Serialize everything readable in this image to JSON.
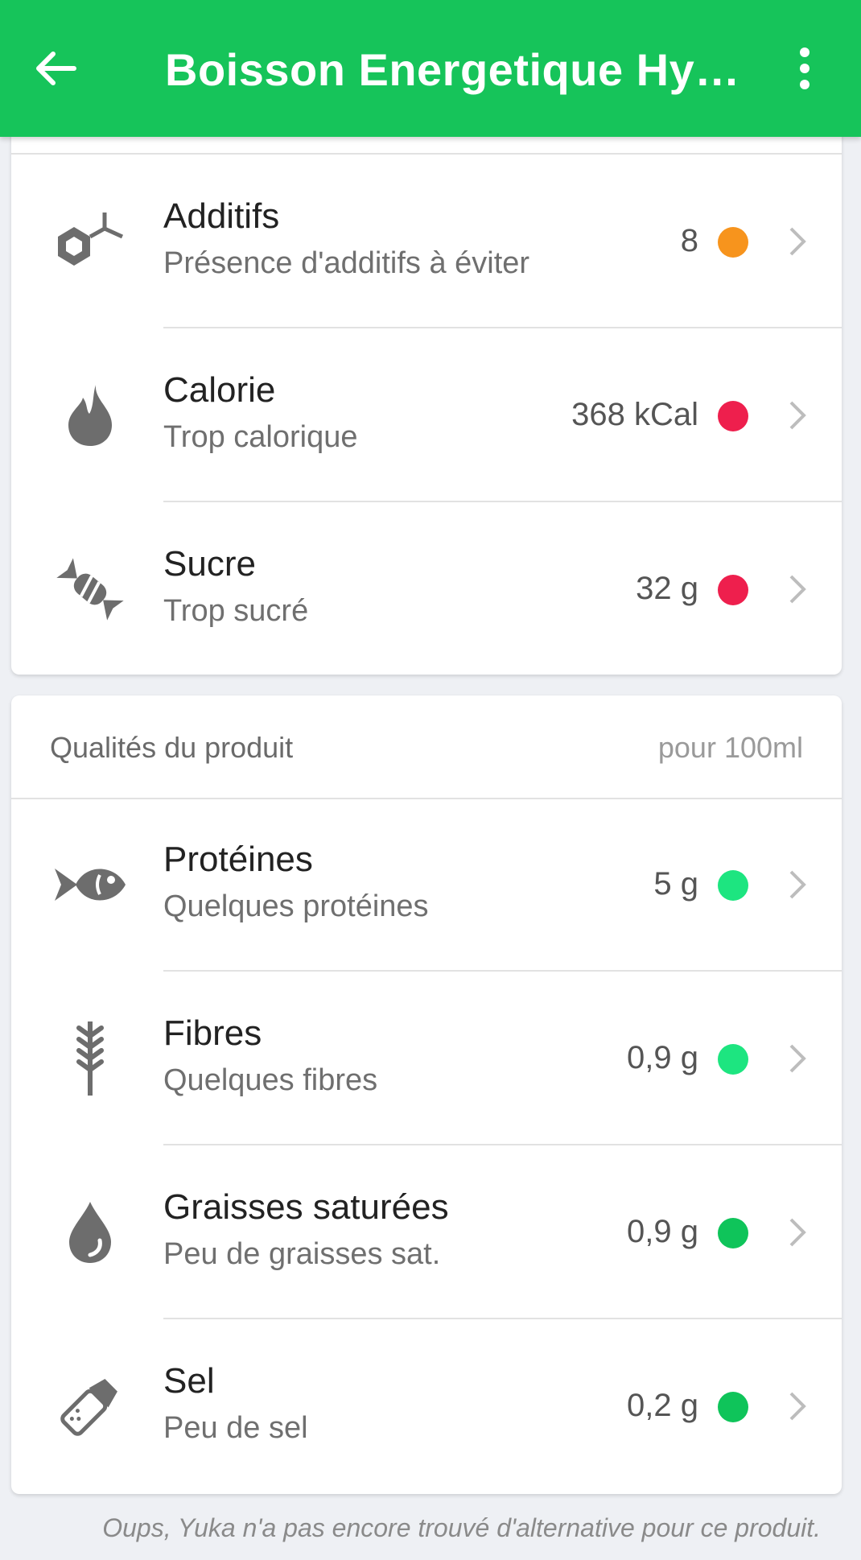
{
  "appbar": {
    "title": "Boisson Energetique Hyd…",
    "back_icon": "arrow-left-icon",
    "menu_icon": "more-vert-icon"
  },
  "defauts": [
    {
      "name": "Additifs",
      "desc": "Présence d'additifs à éviter",
      "value": "8",
      "color": "#f7941d",
      "icon": "molecule-icon"
    },
    {
      "name": "Calorie",
      "desc": "Trop calorique",
      "value": "368 kCal",
      "color": "#ee1f4d",
      "icon": "flame-icon"
    },
    {
      "name": "Sucre",
      "desc": "Trop sucré",
      "value": "32 g",
      "color": "#ee1f4d",
      "icon": "candy-icon"
    }
  ],
  "qualites": {
    "header": "Qualités du produit",
    "unit": "pour 100ml",
    "items": [
      {
        "name": "Protéines",
        "desc": "Quelques protéines",
        "value": "5 g",
        "color": "#1de580",
        "icon": "fish-icon"
      },
      {
        "name": "Fibres",
        "desc": "Quelques fibres",
        "value": "0,9 g",
        "color": "#1de580",
        "icon": "wheat-icon"
      },
      {
        "name": "Graisses saturées",
        "desc": "Peu de graisses sat.",
        "value": "0,9 g",
        "color": "#0fc45a",
        "icon": "drop-icon"
      },
      {
        "name": "Sel",
        "desc": "Peu de sel",
        "value": "0,2 g",
        "color": "#0fc45a",
        "icon": "salt-shaker-icon"
      }
    ]
  },
  "footer_note": "Oups, Yuka n'a pas encore trouvé d'alternative pour ce produit."
}
